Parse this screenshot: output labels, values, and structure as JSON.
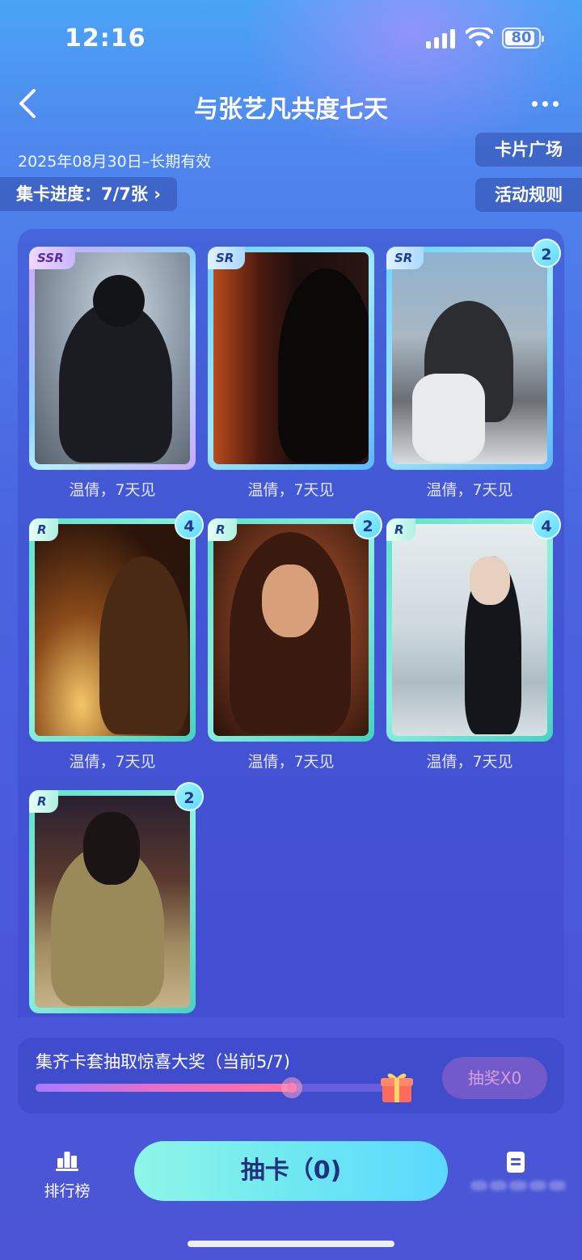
{
  "status_bar": {
    "time": "12:16",
    "battery": "80"
  },
  "header": {
    "title": "与张艺凡共度七天"
  },
  "meta": {
    "date_range": "2025年08月30日–长期有效",
    "progress_label": "集卡进度：7/7张 ›",
    "card_square_label": "卡片广场",
    "rules_label": "活动规则"
  },
  "cards": [
    {
      "rarity": "SSR",
      "caption": "温倩，7天见",
      "count": ""
    },
    {
      "rarity": "SR",
      "caption": "温倩，7天见",
      "count": ""
    },
    {
      "rarity": "SR",
      "caption": "温倩，7天见",
      "count": "2"
    },
    {
      "rarity": "R",
      "caption": "温倩，7天见",
      "count": "4"
    },
    {
      "rarity": "R",
      "caption": "温倩，7天见",
      "count": "2"
    },
    {
      "rarity": "R",
      "caption": "温倩，7天见",
      "count": "4"
    },
    {
      "rarity": "R",
      "caption": "",
      "count": "2"
    }
  ],
  "reward": {
    "text": "集齐卡套抽取惊喜大奖（当前5/7)",
    "progress": 0.71,
    "draw_label": "抽奖X0"
  },
  "bottom": {
    "rank_label": "排行榜",
    "draw_card_label": "抽卡（0)"
  },
  "colors": {
    "accent": "#5ad8ff",
    "background": "#4a57da"
  }
}
